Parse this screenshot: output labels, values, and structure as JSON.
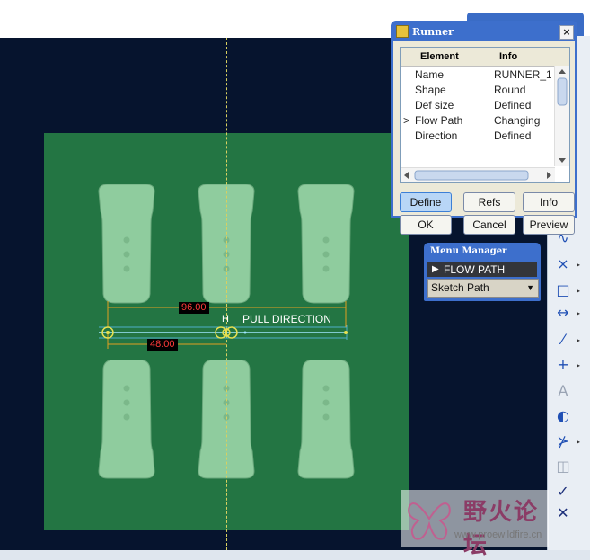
{
  "runner_dialog": {
    "title": "Runner",
    "columns": [
      "Element",
      "Info"
    ],
    "rows": [
      {
        "pointer": "",
        "element": "Name",
        "info": "RUNNER_1"
      },
      {
        "pointer": "",
        "element": "Shape",
        "info": "Round"
      },
      {
        "pointer": "",
        "element": "Def size",
        "info": "Defined"
      },
      {
        "pointer": ">",
        "element": "Flow Path",
        "info": "Changing"
      },
      {
        "pointer": "",
        "element": "Direction",
        "info": "Defined"
      }
    ],
    "buttons": {
      "define": "Define",
      "refs": "Refs",
      "info": "Info",
      "ok": "OK",
      "cancel": "Cancel",
      "preview": "Preview"
    }
  },
  "menu_manager": {
    "title": "Menu Manager",
    "items": [
      "FLOW PATH"
    ],
    "select_value": "Sketch Path"
  },
  "dimensions": {
    "d1": "96.00",
    "d2": "48.00",
    "h_label": "H",
    "pull_direction": "PULL DIRECTION"
  },
  "watermark": {
    "text": "野火论坛",
    "url": "www.proewildfire.cn"
  },
  "toolbar_icons": [
    "sketch-spline-icon",
    "point-icon",
    "rectangle-icon",
    "dimension-icon",
    "trim-icon",
    "cross-icon",
    "text-icon",
    "palette-icon",
    "divide-icon",
    "mirror-icon",
    "accept-icon",
    "cancel-icon"
  ],
  "colors": {
    "background": "#06142e",
    "mold": "#237543",
    "cavity": "#8fcc9e",
    "dialog_frame": "#3d6fcc"
  }
}
